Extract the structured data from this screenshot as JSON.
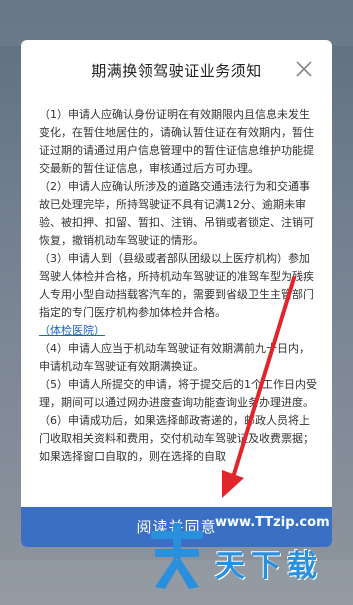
{
  "modal": {
    "title": "期满换领驾驶证业务须知",
    "clauses": [
      "（1）申请人应确认身份证明在有效期限内且信息未发生变化，在暂住地居住的，请确认暂住证在有效期内，暂住证过期的请通过用户信息管理中的暂住证信息维护功能提交最新的暂住证信息，审核通过后方可办理。",
      "（2）申请人应确认所涉及的道路交通违法行为和交通事故已处理完毕，所持驾驶证不具有记满12分、逾期未审验、被扣押、扣留、暂扣、注销、吊销或者锁定、注销可恢复，撤销机动车驾驶证的情形。",
      "（3）申请人到（县级或者部队团级以上医疗机构）参加驾驶人体检并合格，所持机动车驾驶证的准驾车型为残疾人专用小型自动挡载客汽车的，需要到省级卫生主管部门指定的专门医疗机构参加体检并合格。",
      "（4）申请人应当于机动车驾驶证有效期满前九十日内，申请机动车驾驶证有效期满换证。",
      "（5）申请人所提交的申请，将于提交后的1个工作日内受理，期间可以通过网办进度查询功能查询业务办理进度。",
      "（6）申请成功后，如果选择邮政寄递的，邮政人员将上门收取相关资料和费用，交付机动车驾驶证及收费票据；如果选择窗口自取的，则在选择的自取"
    ],
    "link_label": "（体检医院）",
    "agree_label": "阅读并同意"
  },
  "watermark": {
    "url": "www.TTzip.com",
    "name": "天下载"
  },
  "colors": {
    "accent": "#3a6fc4",
    "link": "#1a63c7",
    "arrow": "#e0262b"
  },
  "icons": {
    "close": "close-icon",
    "arrow": "red-arrow-icon"
  }
}
